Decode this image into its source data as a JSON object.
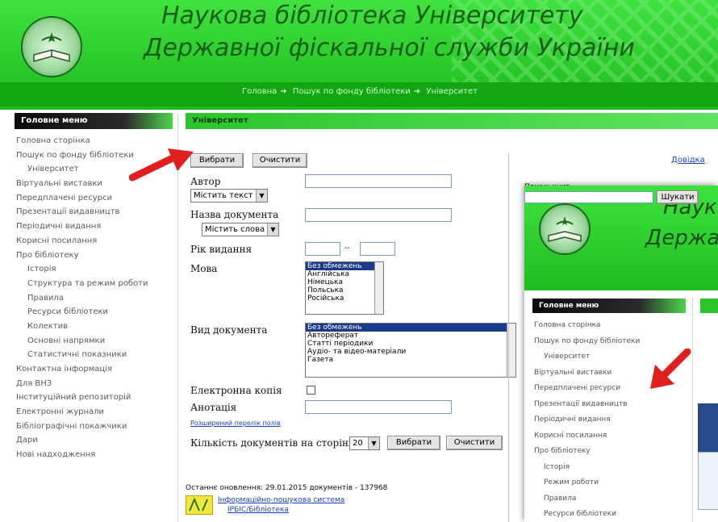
{
  "header": {
    "title_line1": "Наукова бібліотека Університету",
    "title_line2": "Державної фіскальної служби України",
    "breadcrumbs": [
      "Головна",
      "Пошук по фонду бібліотеки",
      "Університет"
    ]
  },
  "sidebar": {
    "heading": "Головне меню",
    "items": [
      {
        "label": "Головна сторінка",
        "sub": false
      },
      {
        "label": "Пошук по фонду бібліотеки",
        "sub": false
      },
      {
        "label": "Університет",
        "sub": true
      },
      {
        "label": "Віртуальні виставки",
        "sub": false
      },
      {
        "label": "Передплачені ресурси",
        "sub": false
      },
      {
        "label": "Презентації видавництв",
        "sub": false
      },
      {
        "label": "Періодичні видання",
        "sub": false
      },
      {
        "label": "Корисні посилання",
        "sub": false
      },
      {
        "label": "Про бібліотеку",
        "sub": false
      },
      {
        "label": "Історія",
        "sub": true
      },
      {
        "label": "Структура та режим роботи",
        "sub": true
      },
      {
        "label": "Правила",
        "sub": true
      },
      {
        "label": "Ресурси бібліотеки",
        "sub": true
      },
      {
        "label": "Колектив",
        "sub": true
      },
      {
        "label": "Основні напрямки",
        "sub": true
      },
      {
        "label": "Статистичні показники",
        "sub": true
      },
      {
        "label": "Контактна інформація",
        "sub": false
      },
      {
        "label": "Для ВНЗ",
        "sub": false
      },
      {
        "label": "Інституційний репозиторій",
        "sub": false
      },
      {
        "label": "Електронні журнали",
        "sub": false
      },
      {
        "label": "Бібліографічні покажчики",
        "sub": false
      },
      {
        "label": "Дари",
        "sub": false
      },
      {
        "label": "Нові надходження",
        "sub": false
      }
    ]
  },
  "main": {
    "heading": "Університет",
    "select_button": "Вибрати",
    "clear_button": "Очистити",
    "fields": {
      "author_label": "Автор",
      "author_mode": "Містить текст",
      "title_label": "Назва документа",
      "title_mode": "Містить слова",
      "year_label": "Рік видання",
      "year_sep": "--",
      "language_label": "Мова",
      "languages": [
        "Без обмежень",
        "Англійська",
        "Німецька",
        "Польська",
        "Російська"
      ],
      "doctype_label": "Вид документа",
      "doctypes": [
        "Без обмежень",
        "Автореферат",
        "Статті періодики",
        "Аудіо- та відео-матеріали",
        "Газета"
      ],
      "ecopy_label": "Електронна копія",
      "annotation_label": "Анотація",
      "advanced_link": "Розширений перелік полів",
      "per_page_label": "Кількість документів на сторінці",
      "per_page_value": "20"
    },
    "stats": "Останнє оновлення: 29.01.2015 документів - 137968",
    "footer_link_line1": "Інформаційно-пошукова система",
    "footer_link_line2": "ІРБІС/Бібліотека",
    "right_link": "Довідка",
    "quick_search_label": "Пошук книг",
    "quick_search_button": "Шукати"
  },
  "overlay": {
    "title_line1": "Наук",
    "title_line2": "Держа",
    "heading": "Головне меню",
    "items": [
      {
        "label": "Головна сторінка",
        "sub": false
      },
      {
        "label": "Пошук по фонду бібліотеки",
        "sub": false
      },
      {
        "label": "Університет",
        "sub": true
      },
      {
        "label": "Віртуальні виставки",
        "sub": false
      },
      {
        "label": "Передплачені ресурси",
        "sub": false
      },
      {
        "label": "Презентації видавництв",
        "sub": false
      },
      {
        "label": "Періодичні видання",
        "sub": false
      },
      {
        "label": "Корисні посилання",
        "sub": false
      },
      {
        "label": "Про бібліотеку",
        "sub": false
      },
      {
        "label": "Історія",
        "sub": true
      },
      {
        "label": "Режим роботи",
        "sub": true
      },
      {
        "label": "Правила",
        "sub": true
      },
      {
        "label": "Ресурси бібліотеки",
        "sub": true
      }
    ]
  },
  "colors": {
    "brand_green": "#2ccc2c",
    "nav_green": "#12a712",
    "arrow_red": "#e01e1e",
    "link_blue": "#1a3fbf"
  }
}
